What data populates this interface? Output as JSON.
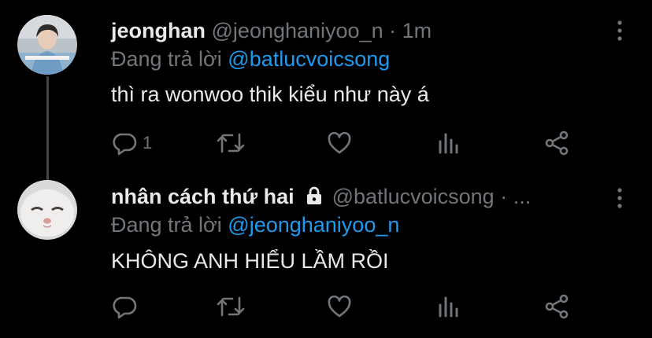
{
  "colors": {
    "background": "#000000",
    "text_primary": "#e7e9ea",
    "text_secondary": "#71767b",
    "accent": "#1d9bf0",
    "thread_line": "#424649"
  },
  "tweets": [
    {
      "display_name": "jeonghan",
      "handle": "@jeonghaniyoo_n",
      "separator": "·",
      "time": "1m",
      "protected": false,
      "reply_prefix": "Đang trả lời",
      "reply_to": "@batlucvoicsong",
      "text": "thì ra wonwoo thik kiểu như này á",
      "reply_count": "1",
      "avatar": "avatar-photo-person",
      "icons": [
        "reply-icon",
        "retweet-icon",
        "like-icon",
        "views-icon",
        "share-icon",
        "more-icon"
      ]
    },
    {
      "display_name": "nhân cách thứ hai",
      "handle": "@batlucvoicsong",
      "separator": "·",
      "time": "...",
      "protected": true,
      "reply_prefix": "Đang trả lời",
      "reply_to": "@jeonghaniyoo_n",
      "text": "KHÔNG ANH HIỂU LẦM RỒI",
      "reply_count": "",
      "avatar": "avatar-photo-cat",
      "icons": [
        "lock-icon",
        "reply-icon",
        "retweet-icon",
        "like-icon",
        "views-icon",
        "share-icon",
        "more-icon"
      ]
    }
  ]
}
